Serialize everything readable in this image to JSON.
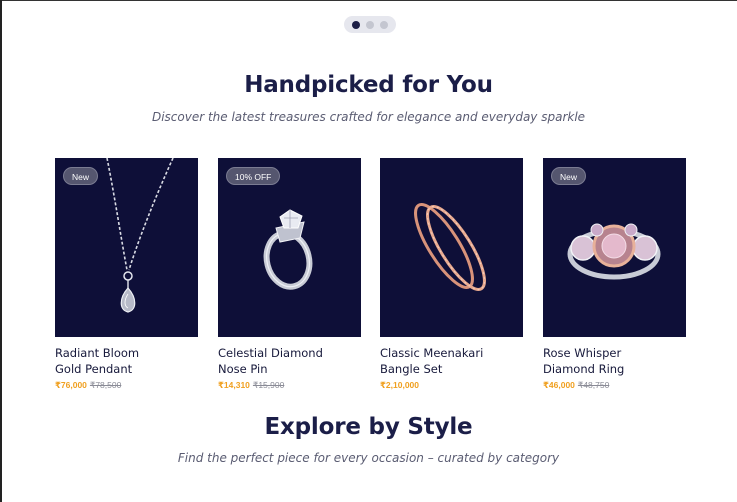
{
  "carousel": {
    "dots": 3,
    "active_index": 0
  },
  "handpicked": {
    "title": "Handpicked for You",
    "subtitle": "Discover the latest treasures crafted for elegance and everyday sparkle",
    "products": [
      {
        "badge": "New",
        "name_line1": "Radiant Bloom",
        "name_line2": "Gold Pendant",
        "price": "₹76,000",
        "mrp": "₹78,500",
        "icon": "pendant-necklace"
      },
      {
        "badge": "10% OFF",
        "name_line1": "Celestial Diamond",
        "name_line2": "Nose Pin",
        "price": "₹14,310",
        "mrp": "₹15,900",
        "icon": "diamond-ring"
      },
      {
        "badge": "",
        "name_line1": "Classic Meenakari",
        "name_line2": "Bangle Set",
        "price": "₹2,10,000",
        "mrp": "",
        "icon": "bangle-set"
      },
      {
        "badge": "New",
        "name_line1": "Rose Whisper",
        "name_line2": "Diamond Ring",
        "price": "₹46,000",
        "mrp": "₹48,750",
        "icon": "rose-gem-ring"
      }
    ]
  },
  "explore": {
    "title": "Explore by Style",
    "subtitle": "Find the perfect piece for every occasion – curated by category"
  },
  "colors": {
    "navy": "#1b1e48",
    "card_bg": "#0e0f38",
    "price": "#f0a020"
  }
}
